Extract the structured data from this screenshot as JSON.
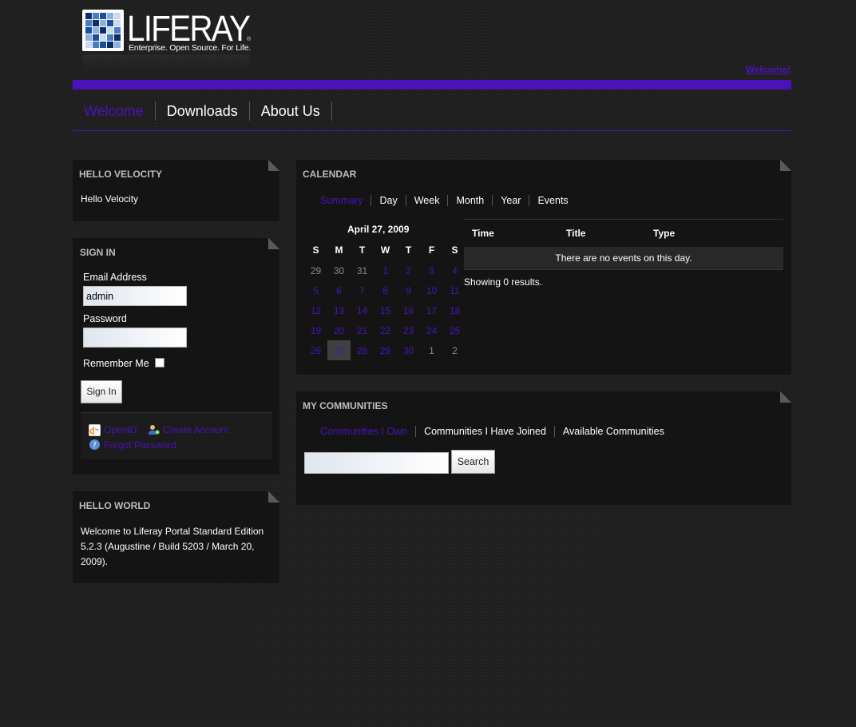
{
  "brand": {
    "name": "LIFERAY",
    "tagline": "Enterprise. Open Source. For Life.",
    "registered_mark": "®",
    "accent_color": "#4a12b8"
  },
  "header": {
    "welcome_link": "Welcome!"
  },
  "nav": {
    "items": [
      "Welcome",
      "Downloads",
      "About Us"
    ],
    "active": "Welcome"
  },
  "portlets": {
    "hello_velocity": {
      "title": "HELLO VELOCITY",
      "body": "Hello Velocity"
    },
    "sign_in": {
      "title": "SIGN IN",
      "email_label": "Email Address",
      "email_value": "admin",
      "password_label": "Password",
      "password_value": "",
      "remember_label": "Remember Me",
      "remember_checked": false,
      "submit_label": "Sign In",
      "links": {
        "openid": "OpenID",
        "create_account": "Create Account",
        "forgot_password": "Forgot Password"
      }
    },
    "hello_world": {
      "title": "HELLO WORLD",
      "body": "Welcome to Liferay Portal Standard Edition 5.2.3 (Augustine / Build 5203 / March 20, 2009)."
    },
    "calendar": {
      "title": "CALENDAR",
      "tabs": [
        "Summary",
        "Day",
        "Week",
        "Month",
        "Year",
        "Events"
      ],
      "active_tab": "Summary",
      "date_heading": "April 27, 2009",
      "weekdays": [
        "S",
        "M",
        "T",
        "W",
        "T",
        "F",
        "S"
      ],
      "weeks": [
        [
          "29",
          "30",
          "31",
          "1",
          "2",
          "3",
          "4"
        ],
        [
          "5",
          "6",
          "7",
          "8",
          "9",
          "10",
          "11"
        ],
        [
          "12",
          "13",
          "14",
          "15",
          "16",
          "17",
          "18"
        ],
        [
          "19",
          "20",
          "21",
          "22",
          "23",
          "24",
          "25"
        ],
        [
          "26",
          "27",
          "28",
          "29",
          "30",
          "1",
          "2"
        ]
      ],
      "today": "27",
      "events_columns": [
        "Time",
        "Title",
        "Type"
      ],
      "no_events": "There are no events on this day.",
      "results": "Showing 0 results."
    },
    "communities": {
      "title": "MY COMMUNITIES",
      "tabs": [
        "Communities I Own",
        "Communities I Have Joined",
        "Available Communities"
      ],
      "active_tab": "Communities I Own",
      "search_value": "",
      "search_button": "Search"
    }
  }
}
